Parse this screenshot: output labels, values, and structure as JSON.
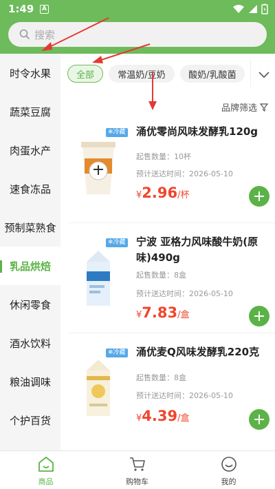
{
  "status_bar": {
    "time": "1:49",
    "notification_icon": "A"
  },
  "search": {
    "placeholder": "搜索"
  },
  "sidebar": {
    "items": [
      {
        "label": "时令水果"
      },
      {
        "label": "蔬菜豆腐"
      },
      {
        "label": "肉蛋水产"
      },
      {
        "label": "速食冻品"
      },
      {
        "label": "预制菜熟食"
      },
      {
        "label": "乳品烘焙"
      },
      {
        "label": "休闲零食"
      },
      {
        "label": "酒水饮料"
      },
      {
        "label": "粮油调味"
      },
      {
        "label": "个护百货"
      }
    ],
    "active_index": 5
  },
  "tabs": [
    {
      "label": "全部"
    },
    {
      "label": "常温奶/豆奶"
    },
    {
      "label": "酸奶/乳酸菌"
    }
  ],
  "brand_filter": {
    "label": "品牌筛选"
  },
  "products": [
    {
      "badge": "❄冷藏",
      "name": "涌优零尚风味发酵乳120g",
      "min_qty": "起售数量：10杯",
      "eta": "预计送达时间：2026-05-10",
      "currency": "¥",
      "price": "2.96",
      "unit": "/杯"
    },
    {
      "badge": "❄冷藏",
      "name": "宁波 亚格力风味酸牛奶(原味)490g",
      "min_qty": "起售数量：8盒",
      "eta": "预计送达时间：2026-05-10",
      "currency": "¥",
      "price": "7.83",
      "unit": "/盒"
    },
    {
      "badge": "❄冷藏",
      "name": "涌优麦Q风味发酵乳220克",
      "min_qty": "起售数量：8盒",
      "eta": "预计送达时间：2026-05-10",
      "currency": "¥",
      "price": "4.39",
      "unit": "/盒"
    }
  ],
  "bottom_nav": [
    {
      "label": "商品",
      "icon": "home-icon"
    },
    {
      "label": "购物车",
      "icon": "cart-icon"
    },
    {
      "label": "我的",
      "icon": "profile-icon"
    }
  ],
  "colors": {
    "brand_green": "#6dbb5a",
    "price_red": "#f0462d",
    "badge_blue": "#56a8e8",
    "arrow_red": "#e53935"
  }
}
